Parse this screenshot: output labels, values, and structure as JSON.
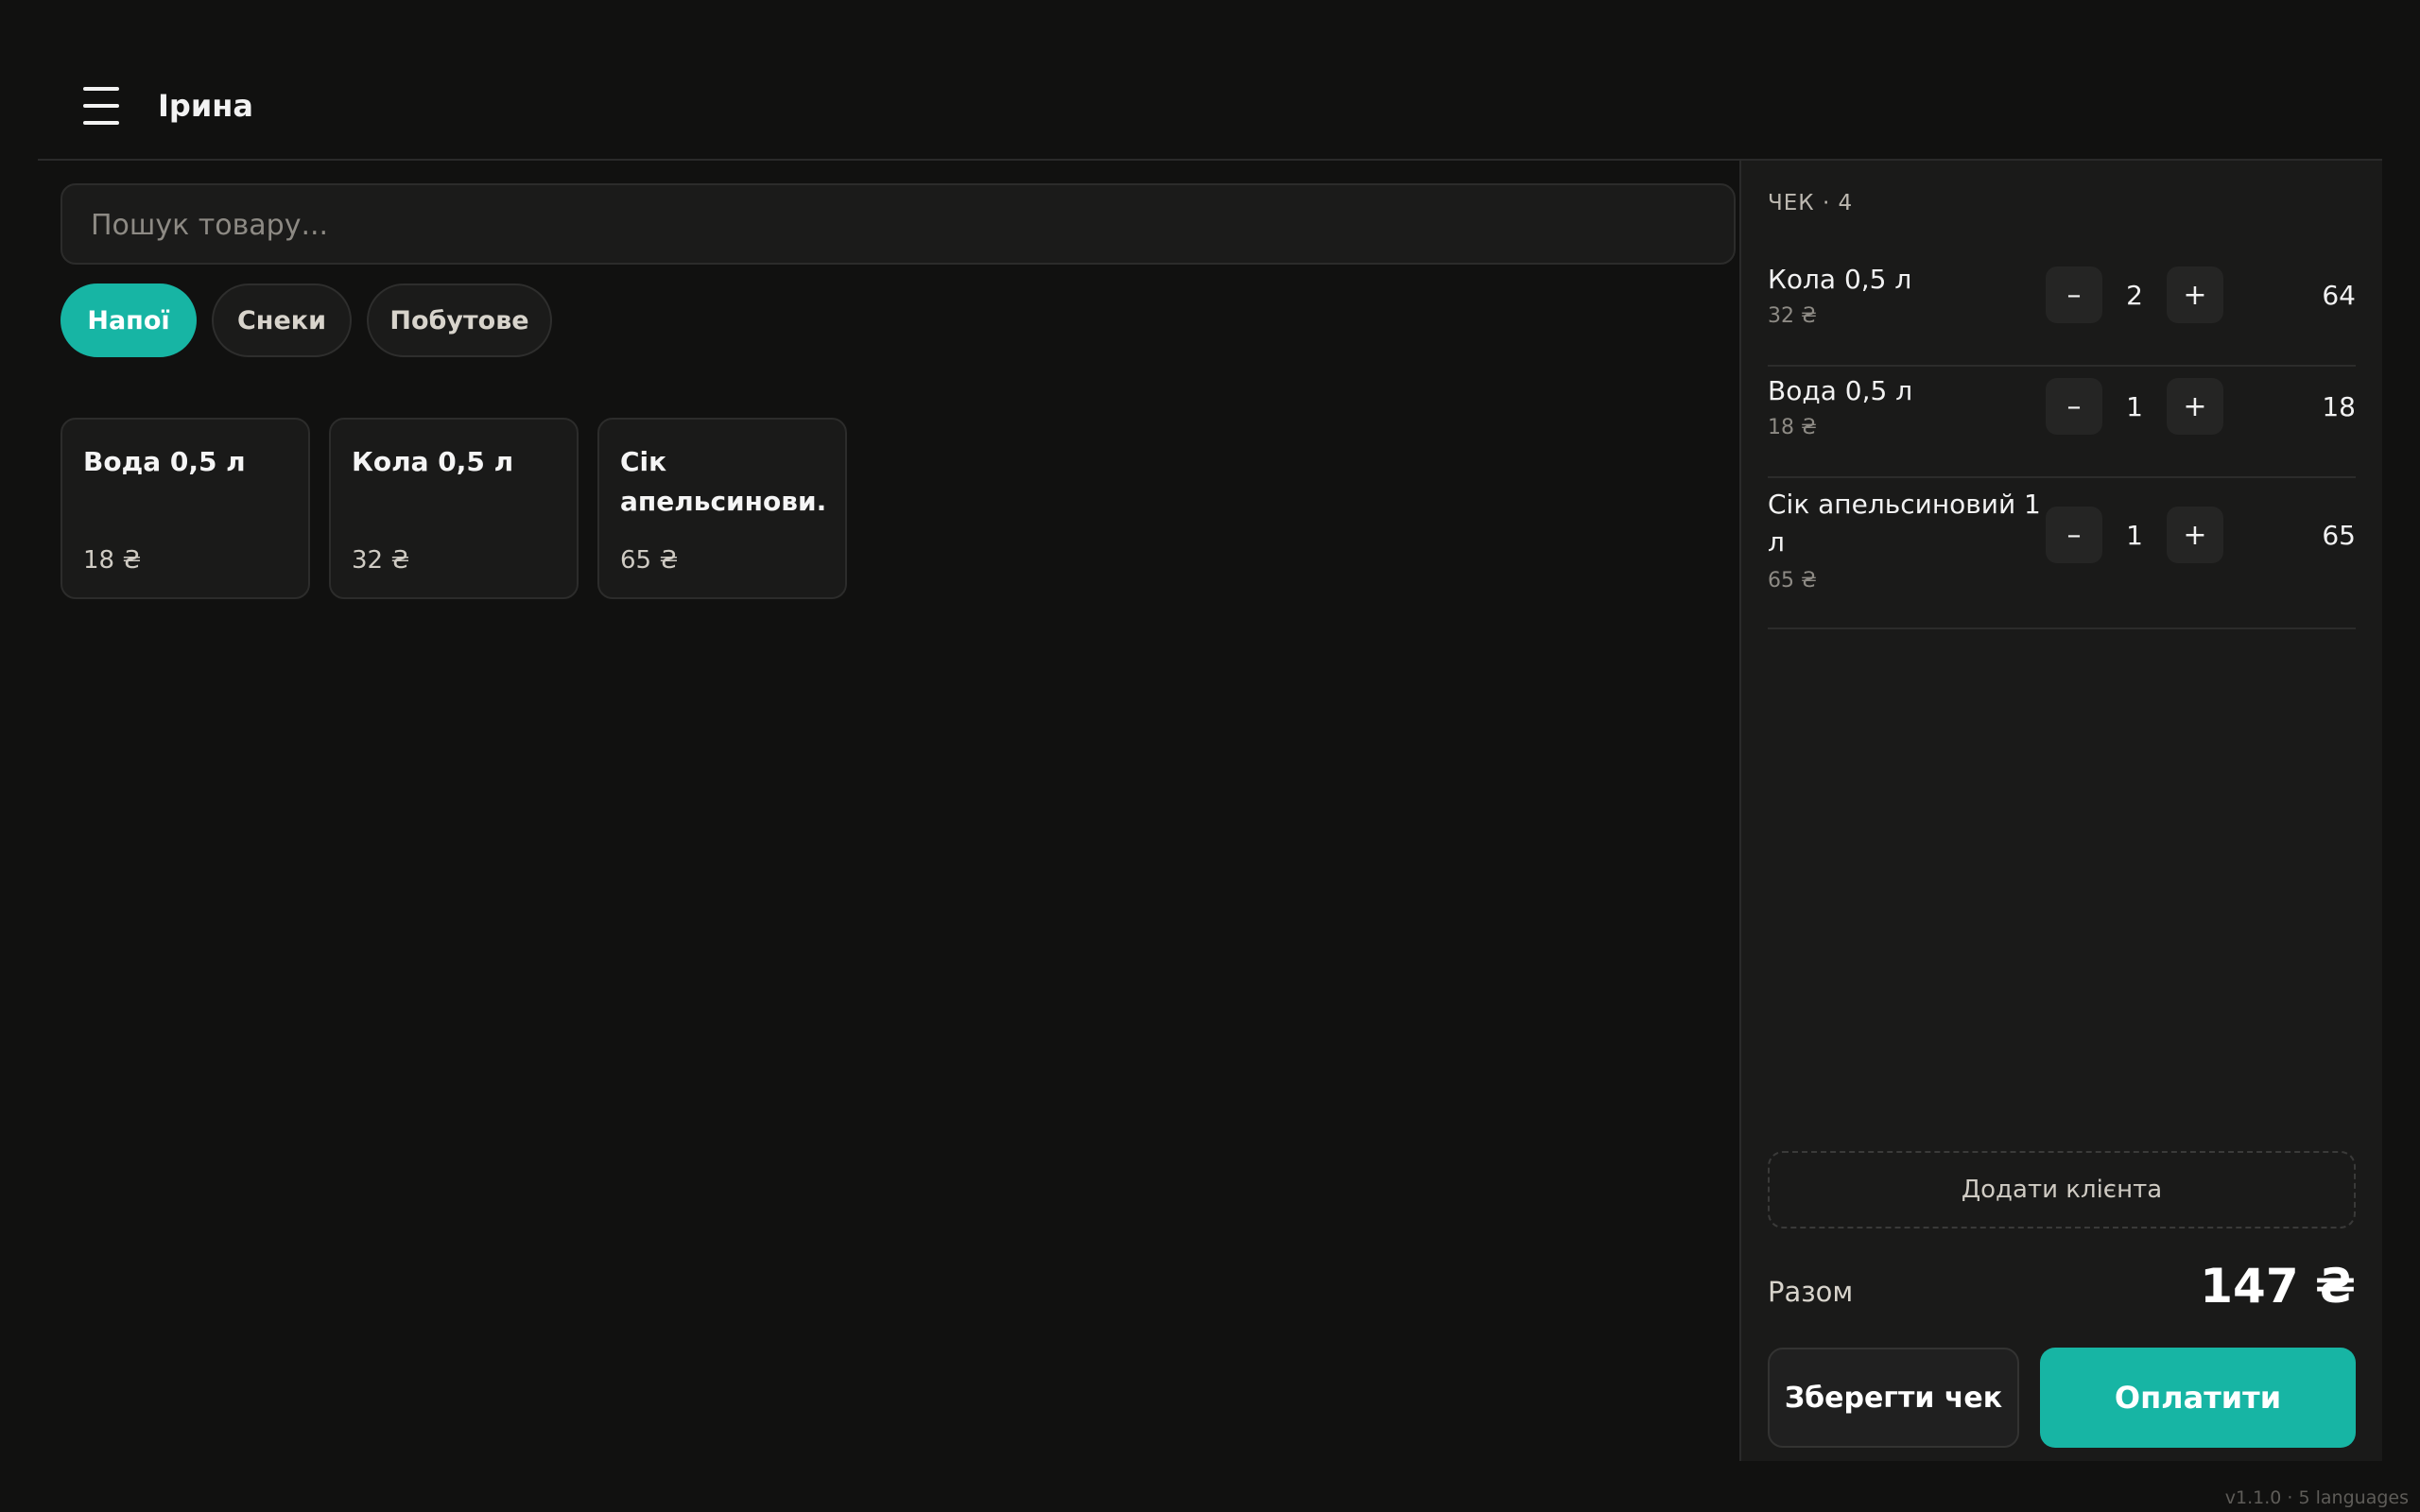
{
  "header": {
    "user_name": "Ірина"
  },
  "search": {
    "placeholder": "Пошук товару..."
  },
  "categories": [
    {
      "label": "Напої",
      "active": true
    },
    {
      "label": "Снеки",
      "active": false
    },
    {
      "label": "Побутове",
      "active": false
    }
  ],
  "products": [
    {
      "name": "Вода 0,5 л",
      "price": "18 ₴"
    },
    {
      "name": "Кола 0,5 л",
      "price": "32 ₴"
    },
    {
      "name": "Сік апельсинови...",
      "price": "65 ₴"
    }
  ],
  "cart": {
    "title": "ЧЕК · 4",
    "minus_label": "–",
    "plus_label": "+",
    "lines": [
      {
        "name": "Кола 0,5 л",
        "unit_price": "32 ₴",
        "qty": "2",
        "total": "64"
      },
      {
        "name": "Вода 0,5 л",
        "unit_price": "18 ₴",
        "qty": "1",
        "total": "18"
      },
      {
        "name": "Сік апельсиновий 1 л",
        "unit_price": "65 ₴",
        "qty": "1",
        "total": "65"
      }
    ],
    "add_client_label": "Додати клієнта",
    "total_label": "Разом",
    "total_value": "147 ₴",
    "save_label": "Зберегти чек",
    "pay_label": "Оплатити"
  },
  "footer": {
    "version": "v1.1.0 · 5 languages"
  },
  "colors": {
    "accent": "#17b5a4",
    "background": "#111110",
    "panel": "#1a1a19"
  }
}
